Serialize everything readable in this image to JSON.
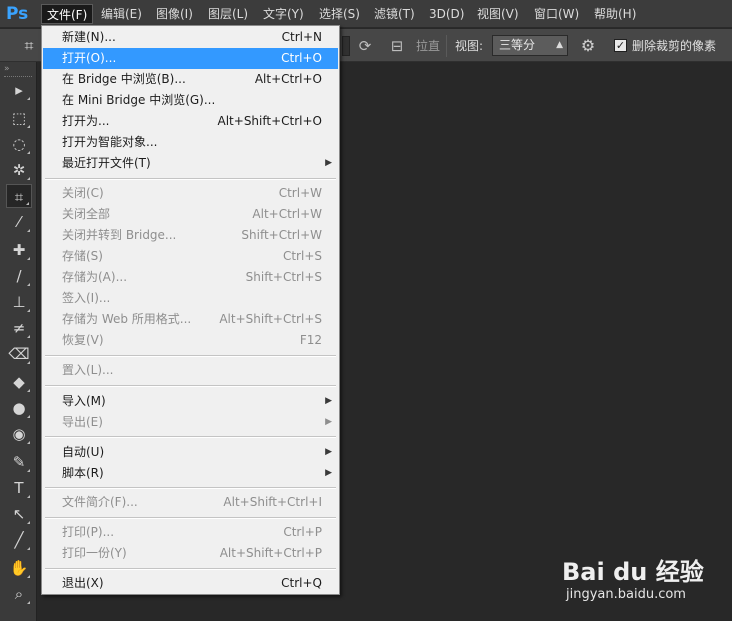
{
  "app": {
    "logo": "Ps"
  },
  "menubar": {
    "items": [
      {
        "label": "文件(F)",
        "active": true
      },
      {
        "label": "编辑(E)"
      },
      {
        "label": "图像(I)"
      },
      {
        "label": "图层(L)"
      },
      {
        "label": "文字(Y)"
      },
      {
        "label": "选择(S)"
      },
      {
        "label": "滤镜(T)"
      },
      {
        "label": "3D(D)"
      },
      {
        "label": "视图(V)"
      },
      {
        "label": "窗口(W)"
      },
      {
        "label": "帮助(H)"
      }
    ]
  },
  "options": {
    "straighten_label": "拉直",
    "view_label": "视图:",
    "view_value": "三等分",
    "delete_cropped_label": "删除裁剪的像素",
    "delete_cropped_checked": true,
    "icons": [
      "crop-tool-icon",
      "rotate-icon",
      "straighten-icon",
      "gear-icon"
    ]
  },
  "toolbar": {
    "tools": [
      {
        "name": "move-tool-icon",
        "glyph": "▸"
      },
      {
        "name": "marquee-tool-icon",
        "glyph": "⬚"
      },
      {
        "name": "lasso-tool-icon",
        "glyph": "◌"
      },
      {
        "name": "magic-wand-tool-icon",
        "glyph": "✲"
      },
      {
        "name": "crop-tool-icon",
        "glyph": "⌗",
        "selected": true
      },
      {
        "name": "eyedropper-tool-icon",
        "glyph": "⁄"
      },
      {
        "name": "healing-brush-tool-icon",
        "glyph": "✚"
      },
      {
        "name": "brush-tool-icon",
        "glyph": "/"
      },
      {
        "name": "clone-stamp-tool-icon",
        "glyph": "⊥"
      },
      {
        "name": "history-brush-tool-icon",
        "glyph": "≠"
      },
      {
        "name": "eraser-tool-icon",
        "glyph": "⌫"
      },
      {
        "name": "paint-bucket-tool-icon",
        "glyph": "◆"
      },
      {
        "name": "blur-tool-icon",
        "glyph": "●"
      },
      {
        "name": "dodge-tool-icon",
        "glyph": "◉"
      },
      {
        "name": "pen-tool-icon",
        "glyph": "✎"
      },
      {
        "name": "type-tool-icon",
        "glyph": "T"
      },
      {
        "name": "path-selection-tool-icon",
        "glyph": "↖"
      },
      {
        "name": "line-tool-icon",
        "glyph": "╱"
      },
      {
        "name": "hand-tool-icon",
        "glyph": "✋"
      },
      {
        "name": "zoom-tool-icon",
        "glyph": "⌕"
      }
    ]
  },
  "filemenu": {
    "items": [
      {
        "label": "新建(N)...",
        "shortcut": "Ctrl+N"
      },
      {
        "label": "打开(O)...",
        "shortcut": "Ctrl+O",
        "highlighted": true
      },
      {
        "label": "在 Bridge 中浏览(B)...",
        "shortcut": "Alt+Ctrl+O"
      },
      {
        "label": "在 Mini Bridge 中浏览(G)...",
        "shortcut": ""
      },
      {
        "label": "打开为...",
        "shortcut": "Alt+Shift+Ctrl+O"
      },
      {
        "label": "打开为智能对象...",
        "shortcut": ""
      },
      {
        "label": "最近打开文件(T)",
        "shortcut": "",
        "submenu": true
      },
      {
        "separator": true
      },
      {
        "label": "关闭(C)",
        "shortcut": "Ctrl+W",
        "disabled": true
      },
      {
        "label": "关闭全部",
        "shortcut": "Alt+Ctrl+W",
        "disabled": true
      },
      {
        "label": "关闭并转到 Bridge...",
        "shortcut": "Shift+Ctrl+W",
        "disabled": true
      },
      {
        "label": "存储(S)",
        "shortcut": "Ctrl+S",
        "disabled": true
      },
      {
        "label": "存储为(A)...",
        "shortcut": "Shift+Ctrl+S",
        "disabled": true
      },
      {
        "label": "签入(I)...",
        "shortcut": "",
        "disabled": true
      },
      {
        "label": "存储为 Web 所用格式...",
        "shortcut": "Alt+Shift+Ctrl+S",
        "disabled": true
      },
      {
        "label": "恢复(V)",
        "shortcut": "F12",
        "disabled": true
      },
      {
        "separator": true
      },
      {
        "label": "置入(L)...",
        "shortcut": "",
        "disabled": true
      },
      {
        "separator": true
      },
      {
        "label": "导入(M)",
        "shortcut": "",
        "submenu": true
      },
      {
        "label": "导出(E)",
        "shortcut": "",
        "submenu": true,
        "disabled": true
      },
      {
        "separator": true
      },
      {
        "label": "自动(U)",
        "shortcut": "",
        "submenu": true
      },
      {
        "label": "脚本(R)",
        "shortcut": "",
        "submenu": true
      },
      {
        "separator": true
      },
      {
        "label": "文件简介(F)...",
        "shortcut": "Alt+Shift+Ctrl+I",
        "disabled": true
      },
      {
        "separator": true
      },
      {
        "label": "打印(P)...",
        "shortcut": "Ctrl+P",
        "disabled": true
      },
      {
        "label": "打印一份(Y)",
        "shortcut": "Alt+Shift+Ctrl+P",
        "disabled": true
      },
      {
        "separator": true
      },
      {
        "label": "退出(X)",
        "shortcut": "Ctrl+Q"
      }
    ]
  },
  "watermark": {
    "brand": "Bai du 经验",
    "url": "jingyan.baidu.com"
  }
}
